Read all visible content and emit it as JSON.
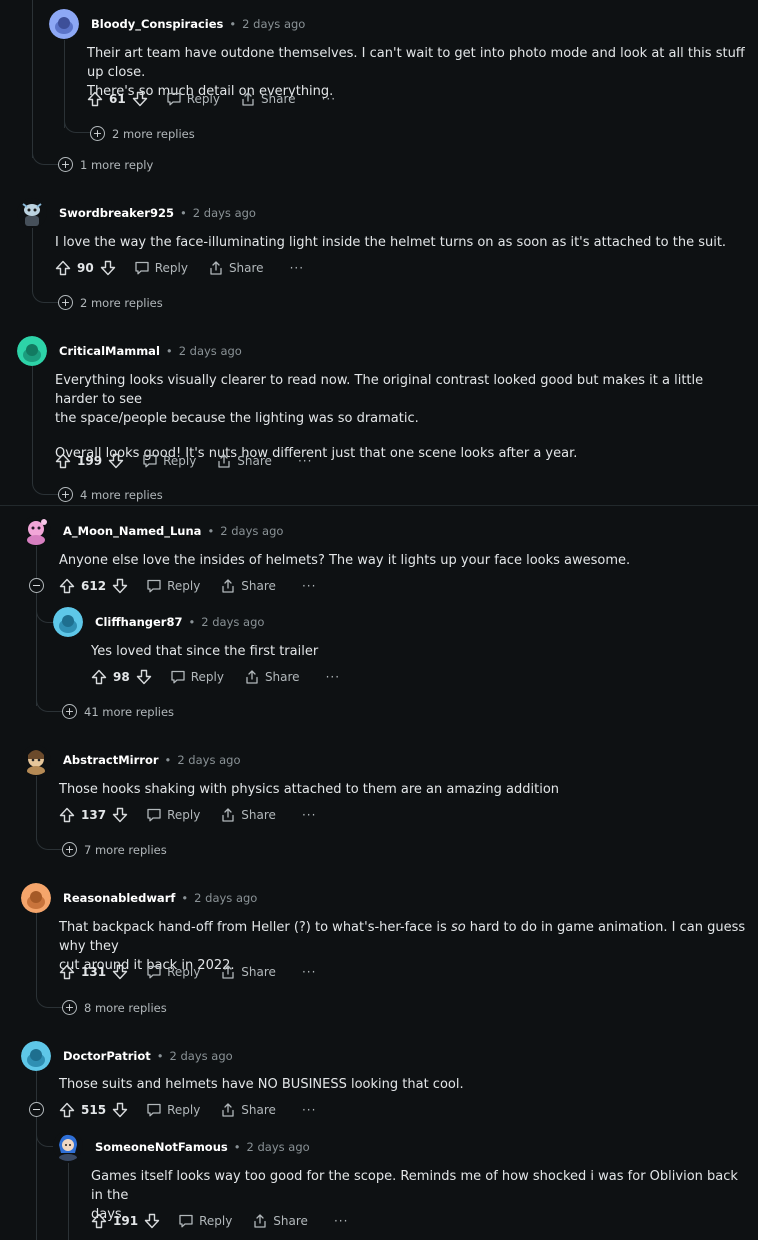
{
  "comments": {
    "c1": {
      "username": "Bloody_Conspiracies",
      "time": "2 days ago",
      "lines": [
        "Their art team have outdone themselves. I can't wait to get into photo mode and look at all this stuff up close.",
        "There's so much detail on everything."
      ],
      "score": "61",
      "more": "2 more replies",
      "outer_more": "1 more reply"
    },
    "c2": {
      "username": "Swordbreaker925",
      "time": "2 days ago",
      "lines": [
        "I love the way the face-illuminating light inside the helmet turns on as soon as it's attached to the suit."
      ],
      "score": "90",
      "more": "2 more replies"
    },
    "c3": {
      "username": "CriticalMammal",
      "time": "2 days ago",
      "lines": [
        "Everything looks visually clearer to read now. The original contrast looked good but makes it a little harder to see",
        "the space/people because the lighting was so dramatic."
      ],
      "para2": "Overall looks good! It's nuts how different just that one scene looks after a year.",
      "score": "199",
      "more": "4 more replies"
    },
    "c4": {
      "username": "A_Moon_Named_Luna",
      "time": "2 days ago",
      "lines": [
        "Anyone else love the insides of helmets? The way it lights up your face looks awesome."
      ],
      "score": "612",
      "more": "41 more replies"
    },
    "c4r": {
      "username": "Cliffhanger87",
      "time": "2 days ago",
      "lines": [
        "Yes loved that since the first trailer"
      ],
      "score": "98"
    },
    "c5": {
      "username": "AbstractMirror",
      "time": "2 days ago",
      "lines": [
        "Those hooks shaking with physics attached to them are an amazing addition"
      ],
      "score": "137",
      "more": "7 more replies"
    },
    "c6": {
      "username": "Reasonabledwarf",
      "time": "2 days ago",
      "line1_pre": "That backpack hand-off from Heller (?) to what's-her-face is ",
      "line1_em": "so",
      "line1_post": " hard to do in game animation. I can guess why they",
      "line2": "cut around it back in 2022.",
      "score": "131",
      "more": "8 more replies"
    },
    "c7": {
      "username": "DoctorPatriot",
      "time": "2 days ago",
      "lines": [
        "Those suits and helmets have NO BUSINESS looking that cool."
      ],
      "score": "515"
    },
    "c7r": {
      "username": "SomeoneNotFamous",
      "time": "2 days ago",
      "lines": [
        "Games itself looks way too good for the scope. Reminds me of how shocked i was for Oblivion back in the",
        "days."
      ],
      "score": "191"
    }
  },
  "actions": {
    "reply": "Reply",
    "share": "Share",
    "more": "···"
  },
  "colors": {
    "bg": "#0e1113",
    "thread_line": "#2b3236",
    "text": "#e3e6e8",
    "muted": "#8a9296"
  },
  "icons": [
    "upvote-icon",
    "downvote-icon",
    "reply-icon",
    "share-icon",
    "expand-icon",
    "collapse-icon",
    "snoo-avatar-icon"
  ]
}
